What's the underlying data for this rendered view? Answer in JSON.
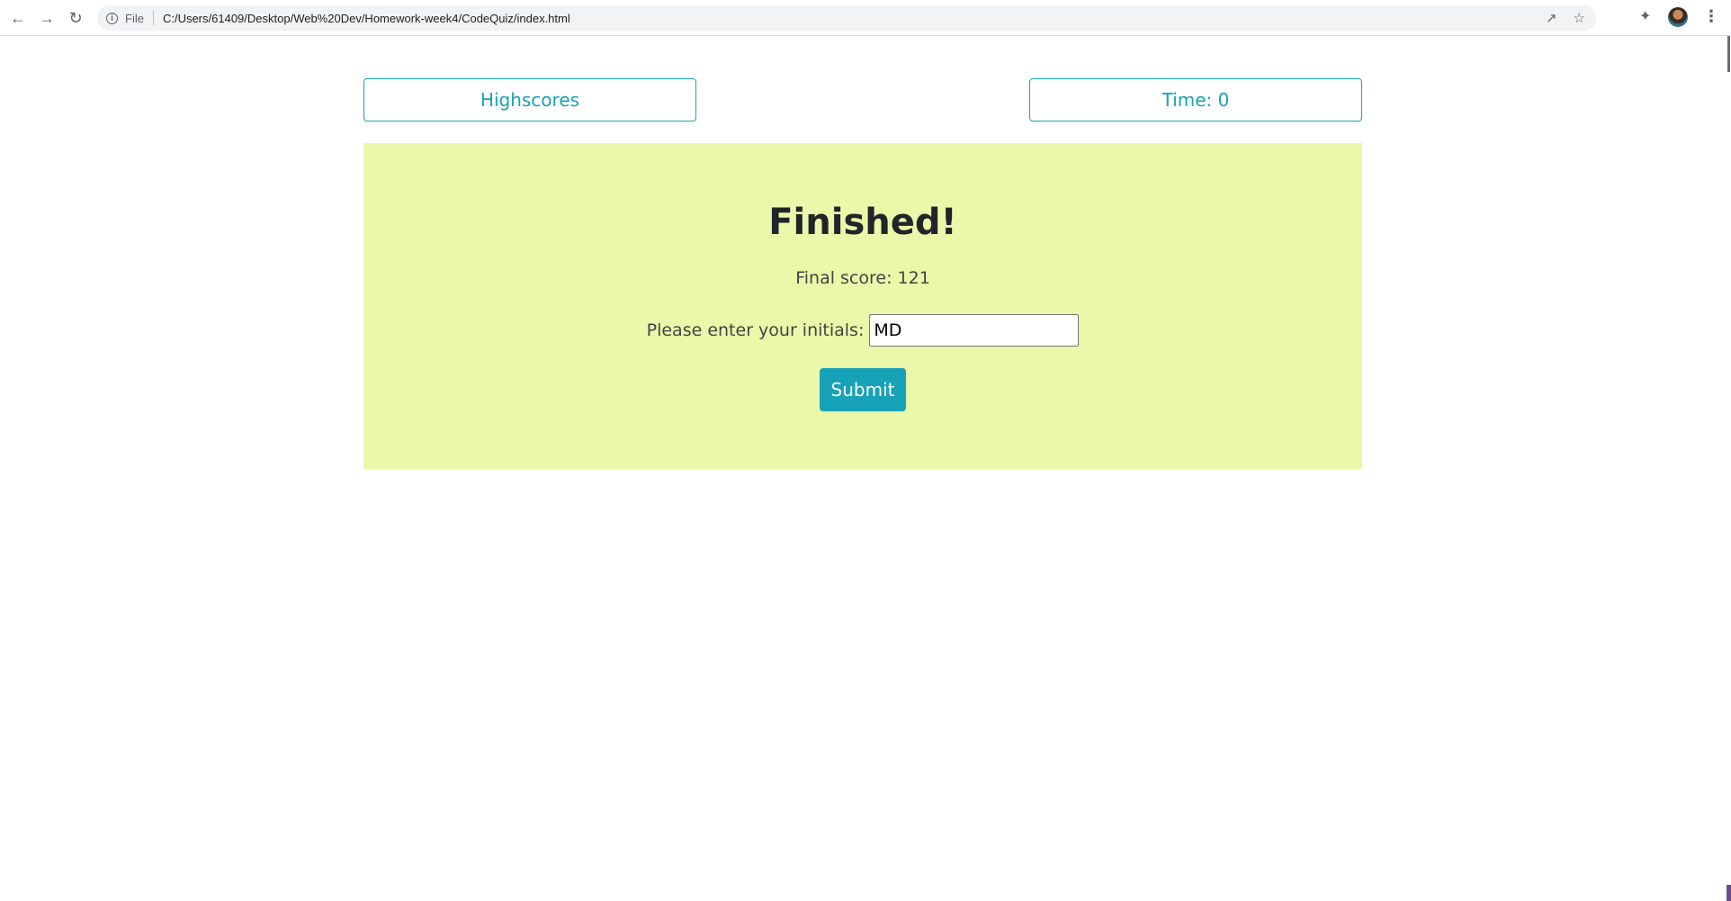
{
  "browser": {
    "site_label": "File",
    "url": "C:/Users/61409/Desktop/Web%20Dev/Homework-week4/CodeQuiz/index.html",
    "icons": {
      "back": "arrow-left-icon",
      "forward": "arrow-right-icon",
      "reload": "reload-icon",
      "info": "info-icon",
      "share": "share-icon",
      "bookmark": "star-icon",
      "extensions": "puzzle-icon",
      "profile": "avatar",
      "menu": "kebab-menu-icon"
    }
  },
  "header": {
    "highscores_label": "Highscores",
    "time_label": "Time: 0"
  },
  "result": {
    "title": "Finished!",
    "score_text": "Final score: 121",
    "initials_label": "Please enter your initials:",
    "initials_value": "MD",
    "submit_label": "Submit"
  },
  "colors": {
    "accent": "#17a2b8",
    "panel_background": "#ebf7a9"
  }
}
